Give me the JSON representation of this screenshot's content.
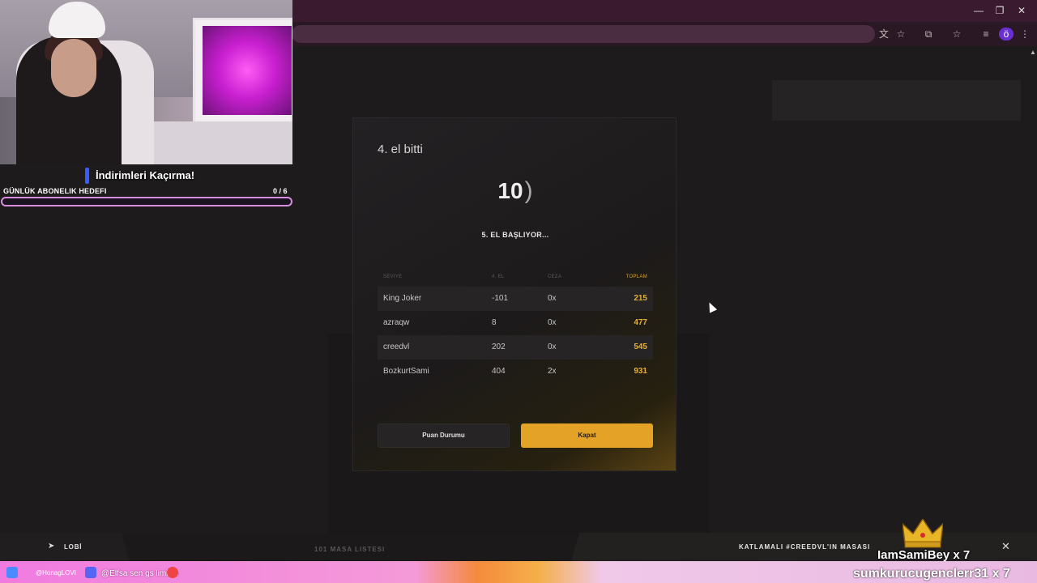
{
  "browser": {
    "window_controls": {
      "minimize": "—",
      "maximize": "❐",
      "close": "✕"
    },
    "profile_initial": "ö"
  },
  "overlay": {
    "promo_text": "İndirimleri Kaçırma!",
    "goal_label": "GÜNLÜK ABONELIK HEDEFI",
    "goal_count": "0  / 6",
    "goal_progress": 0
  },
  "modal": {
    "title": "4. el bitti",
    "countdown": "10",
    "subtitle": "5. EL BAŞLIYOR...",
    "columns": [
      "SEVIYE",
      "4. EL",
      "CEZA",
      "TOPLAM"
    ],
    "rows": [
      {
        "name": "King Joker",
        "hand": "-101",
        "penalty": "0x",
        "total": "215"
      },
      {
        "name": "azraqw",
        "hand": "8",
        "penalty": "0x",
        "total": "477"
      },
      {
        "name": "creedvl",
        "hand": "202",
        "penalty": "0x",
        "total": "545"
      },
      {
        "name": "BozkurtSami",
        "hand": "404",
        "penalty": "2x",
        "total": "931"
      }
    ],
    "score_button": "Puan Durumu",
    "close_button": "Kapat"
  },
  "bottom_bar": {
    "lobby": "LOBİ",
    "table_list": "101 MASA LISTESI",
    "table_name": "KATLAMALI #CREEDVL'IN MASASI",
    "close_icon": "✕"
  },
  "stream": {
    "gift_name": "IamSamiBey  x 7",
    "ticker_tag": "@HonagLOVI",
    "ticker_text": "@Elfsa sen gs limisin",
    "ticker_right": "sumkurucugenclerr31 x 7"
  },
  "colors": {
    "accent": "#e4a326",
    "score": "#e3b13c",
    "goal": "#d98de0"
  }
}
